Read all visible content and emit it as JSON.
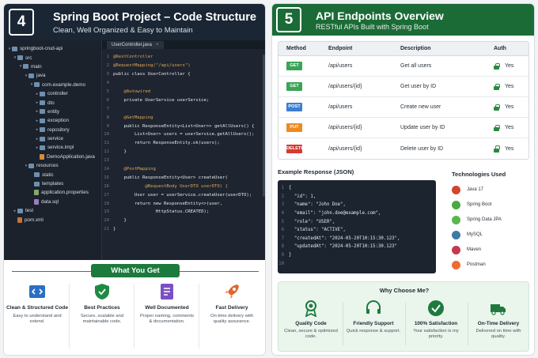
{
  "left": {
    "badge": "4",
    "title": "Spring Boot Project – Code Structure",
    "subtitle": "Clean, Well Organized & Easy to Maintain",
    "tree": [
      {
        "label": "springboot-crud-api",
        "type": "folder",
        "depth": 0,
        "arrow": "▾"
      },
      {
        "label": "src",
        "type": "folder",
        "depth": 1,
        "arrow": "▾"
      },
      {
        "label": "main",
        "type": "folder",
        "depth": 2,
        "arrow": "▾"
      },
      {
        "label": "java",
        "type": "folder",
        "depth": 3,
        "arrow": "▾"
      },
      {
        "label": "com.example.demo",
        "type": "folder",
        "depth": 4,
        "arrow": "▾"
      },
      {
        "label": "controller",
        "type": "folder",
        "depth": 5,
        "arrow": "▸"
      },
      {
        "label": "dto",
        "type": "folder",
        "depth": 5,
        "arrow": "▸"
      },
      {
        "label": "entity",
        "type": "folder",
        "depth": 5,
        "arrow": "▸"
      },
      {
        "label": "exception",
        "type": "folder",
        "depth": 5,
        "arrow": "▸"
      },
      {
        "label": "repository",
        "type": "folder",
        "depth": 5,
        "arrow": "▸"
      },
      {
        "label": "service",
        "type": "folder",
        "depth": 5,
        "arrow": "▸"
      },
      {
        "label": "service.impl",
        "type": "folder",
        "depth": 5,
        "arrow": "▸"
      },
      {
        "label": "DemoApplication.java",
        "type": "file",
        "depth": 5,
        "arrow": ""
      },
      {
        "label": "resources",
        "type": "folder",
        "depth": 3,
        "arrow": "▾"
      },
      {
        "label": "static",
        "type": "folder",
        "depth": 4,
        "arrow": ""
      },
      {
        "label": "templates",
        "type": "folder",
        "depth": 4,
        "arrow": ""
      },
      {
        "label": "application.properties",
        "type": "prop",
        "depth": 4,
        "arrow": ""
      },
      {
        "label": "data.sql",
        "type": "sql",
        "depth": 4,
        "arrow": ""
      },
      {
        "label": "test",
        "type": "folder",
        "depth": 1,
        "arrow": "▸"
      },
      {
        "label": "pom.xml",
        "type": "xml",
        "depth": 1,
        "arrow": ""
      }
    ],
    "tab_label": "UserController.java",
    "tab_close": "×",
    "code": [
      {
        "n": "1",
        "t": "@RestController"
      },
      {
        "n": "2",
        "t": "@RequestMapping(\"/api/users\")"
      },
      {
        "n": "3",
        "t": "public class UserController {"
      },
      {
        "n": "4",
        "t": ""
      },
      {
        "n": "5",
        "t": "    @Autowired"
      },
      {
        "n": "6",
        "t": "    private UserService userService;"
      },
      {
        "n": "7",
        "t": ""
      },
      {
        "n": "8",
        "t": "    @GetMapping"
      },
      {
        "n": "9",
        "t": "    public ResponseEntity<List<User>> getAllUsers() {"
      },
      {
        "n": "10",
        "t": "        List<User> users = userService.getAllUsers();"
      },
      {
        "n": "11",
        "t": "        return ResponseEntity.ok(users);"
      },
      {
        "n": "12",
        "t": "    }"
      },
      {
        "n": "13",
        "t": ""
      },
      {
        "n": "14",
        "t": "    @PostMapping"
      },
      {
        "n": "15",
        "t": "    public ResponseEntity<User> createUser("
      },
      {
        "n": "16",
        "t": "            @RequestBody UserDTO userDTO) {"
      },
      {
        "n": "17",
        "t": "        User user = userService.createUser(userDTO);"
      },
      {
        "n": "18",
        "t": "        return new ResponseEntity<>(user,"
      },
      {
        "n": "19",
        "t": "                HttpStatus.CREATED);"
      },
      {
        "n": "20",
        "t": "    }"
      },
      {
        "n": "21",
        "t": "}"
      }
    ],
    "what_you_get": "What You Get",
    "features": [
      {
        "title": "Clean & Structured Code",
        "desc": "Easy to understand and extend.",
        "icon": "code-icon",
        "color": "#2b6fc4"
      },
      {
        "title": "Best Practices",
        "desc": "Secure, scalable and maintainable code.",
        "icon": "shield-check-icon",
        "color": "#1f8a44"
      },
      {
        "title": "Well Documented",
        "desc": "Proper naming, comments & documentation.",
        "icon": "document-icon",
        "color": "#7b4fc4"
      },
      {
        "title": "Fast Delivery",
        "desc": "On-time delivery with quality assurance.",
        "icon": "rocket-icon",
        "color": "#e0672e"
      }
    ]
  },
  "right": {
    "badge": "5",
    "title": "API Endpoints Overview",
    "subtitle": "RESTful APIs Built with Spring Boot",
    "headers": [
      "Method",
      "Endpoint",
      "Description",
      "Auth"
    ],
    "endpoints": [
      {
        "method": "GET",
        "color": "#3aa556",
        "endpoint": "/api/users",
        "desc": "Get all users",
        "auth": "Yes"
      },
      {
        "method": "GET",
        "color": "#3aa556",
        "endpoint": "/api/users/{id}",
        "desc": "Get user by ID",
        "auth": "Yes"
      },
      {
        "method": "POST",
        "color": "#3b7fd1",
        "endpoint": "/api/users",
        "desc": "Create new user",
        "auth": "Yes"
      },
      {
        "method": "PUT",
        "color": "#ee8a1f",
        "endpoint": "/api/users/{id}",
        "desc": "Update user by ID",
        "auth": "Yes"
      },
      {
        "method": "DELETE",
        "color": "#d63a32",
        "endpoint": "/api/users/{id}",
        "desc": "Delete user by ID",
        "auth": "Yes"
      }
    ],
    "example_title": "Example Response (JSON)",
    "json_lines": [
      {
        "n": "1",
        "t": "{"
      },
      {
        "n": "2",
        "t": "  \"id\": 1,"
      },
      {
        "n": "3",
        "t": "  \"name\": \"John Doe\","
      },
      {
        "n": "4",
        "t": "  \"email\": \"john.doe@example.com\","
      },
      {
        "n": "5",
        "t": "  \"role\": \"USER\","
      },
      {
        "n": "6",
        "t": "  \"status\": \"ACTIVE\","
      },
      {
        "n": "7",
        "t": "  \"createdAt\": \"2024-05-20T10:15:30.123\","
      },
      {
        "n": "8",
        "t": "  \"updatedAt\": \"2024-05-20T10:15:30.123\""
      },
      {
        "n": "9",
        "t": "}"
      },
      {
        "n": "10",
        "t": ""
      }
    ],
    "tech_title": "Technologies Used",
    "technologies": [
      {
        "name": "Java 17",
        "icon": "java-icon",
        "color": "#d2452e"
      },
      {
        "name": "Spring Boot",
        "icon": "spring-boot-icon",
        "color": "#4aa83f"
      },
      {
        "name": "Spring Data JPA",
        "icon": "spring-data-icon",
        "color": "#5cb74a"
      },
      {
        "name": "MySQL",
        "icon": "mysql-icon",
        "color": "#3e7aa6"
      },
      {
        "name": "Maven",
        "icon": "maven-icon",
        "color": "#c23a4b"
      },
      {
        "name": "Postman",
        "icon": "postman-icon",
        "color": "#ef6c2e"
      }
    ],
    "why_title": "Why Choose Me?",
    "why": [
      {
        "name": "Quality Code",
        "desc": "Clean, secure & optimized code.",
        "icon": "award-icon"
      },
      {
        "name": "Friendly Support",
        "desc": "Quick response & support.",
        "icon": "headset-icon"
      },
      {
        "name": "100% Satisfaction",
        "desc": "Your satisfaction is my priority.",
        "icon": "check-circle-icon"
      },
      {
        "name": "On-Time Delivery",
        "desc": "Delivered on time with quality.",
        "icon": "truck-icon"
      }
    ]
  }
}
